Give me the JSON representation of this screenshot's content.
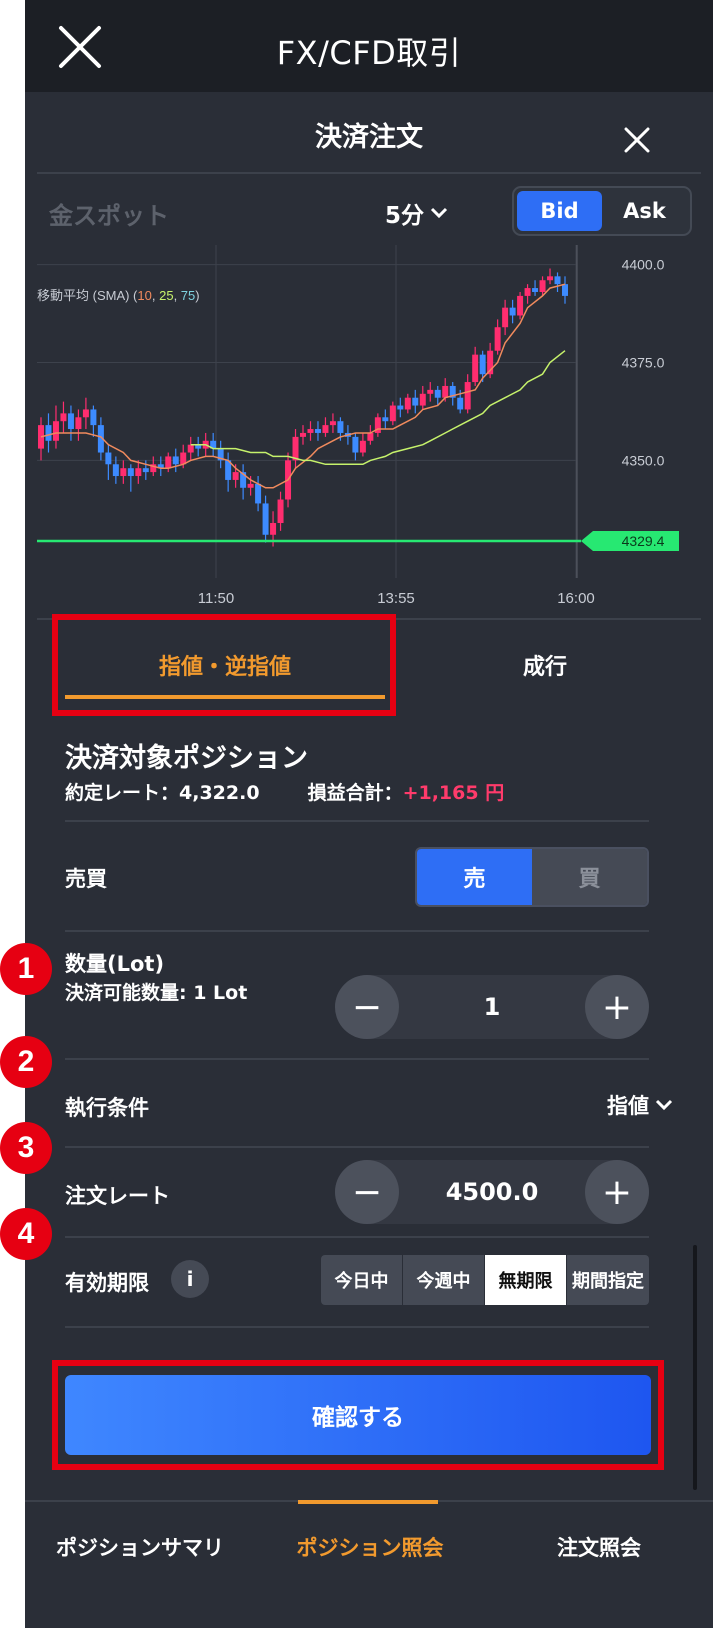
{
  "topbar": {
    "title": "FX/CFD取引",
    "close_icon": "close-icon"
  },
  "modal": {
    "title": "決済注文"
  },
  "chart_header": {
    "symbol": "金スポット",
    "interval": "5分",
    "bid": "Bid",
    "ask": "Ask",
    "selected": "Bid"
  },
  "chart_data": {
    "type": "candlestick",
    "indicator_label": "移動平均 (SMA) (",
    "sma_periods": [
      "10",
      "25",
      "75"
    ],
    "sma_colors": [
      "#f08a5d",
      "#c6f26b",
      "#7fd3e0"
    ],
    "y_ticks": [
      "4400.0",
      "4375.0",
      "4350.0"
    ],
    "y_tick_values": [
      4400,
      4375,
      4350
    ],
    "x_ticks": [
      "11:50",
      "13:55",
      "16:00"
    ],
    "ylim": [
      4322,
      4405
    ],
    "current_price_label": "4329.4",
    "current_price": 4329.4,
    "candles": [
      {
        "o": 4353,
        "c": 4359,
        "h": 4361,
        "l": 4350
      },
      {
        "o": 4359,
        "c": 4355,
        "h": 4362,
        "l": 4352
      },
      {
        "o": 4355,
        "c": 4360,
        "h": 4364,
        "l": 4353
      },
      {
        "o": 4360,
        "c": 4362,
        "h": 4365,
        "l": 4357
      },
      {
        "o": 4362,
        "c": 4358,
        "h": 4364,
        "l": 4355
      },
      {
        "o": 4358,
        "c": 4361,
        "h": 4363,
        "l": 4355
      },
      {
        "o": 4361,
        "c": 4363,
        "h": 4366,
        "l": 4358
      },
      {
        "o": 4363,
        "c": 4359,
        "h": 4364,
        "l": 4356
      },
      {
        "o": 4359,
        "c": 4352,
        "h": 4361,
        "l": 4350
      },
      {
        "o": 4352,
        "c": 4349,
        "h": 4354,
        "l": 4345
      },
      {
        "o": 4349,
        "c": 4346,
        "h": 4351,
        "l": 4344
      },
      {
        "o": 4346,
        "c": 4348,
        "h": 4350,
        "l": 4344
      },
      {
        "o": 4348,
        "c": 4346,
        "h": 4349,
        "l": 4342
      },
      {
        "o": 4346,
        "c": 4348,
        "h": 4350,
        "l": 4344
      },
      {
        "o": 4348,
        "c": 4347,
        "h": 4350,
        "l": 4345
      },
      {
        "o": 4347,
        "c": 4349,
        "h": 4351,
        "l": 4346
      },
      {
        "o": 4349,
        "c": 4348,
        "h": 4351,
        "l": 4346
      },
      {
        "o": 4348,
        "c": 4351,
        "h": 4352,
        "l": 4347
      },
      {
        "o": 4351,
        "c": 4349,
        "h": 4353,
        "l": 4347
      },
      {
        "o": 4349,
        "c": 4352,
        "h": 4354,
        "l": 4348
      },
      {
        "o": 4352,
        "c": 4354,
        "h": 4356,
        "l": 4350
      },
      {
        "o": 4354,
        "c": 4353,
        "h": 4356,
        "l": 4351
      },
      {
        "o": 4353,
        "c": 4355,
        "h": 4357,
        "l": 4351
      },
      {
        "o": 4355,
        "c": 4353,
        "h": 4357,
        "l": 4351
      },
      {
        "o": 4353,
        "c": 4350,
        "h": 4355,
        "l": 4348
      },
      {
        "o": 4350,
        "c": 4345,
        "h": 4352,
        "l": 4342
      },
      {
        "o": 4345,
        "c": 4347,
        "h": 4349,
        "l": 4343
      },
      {
        "o": 4347,
        "c": 4343,
        "h": 4349,
        "l": 4340
      },
      {
        "o": 4343,
        "c": 4344,
        "h": 4346,
        "l": 4341
      },
      {
        "o": 4344,
        "c": 4339,
        "h": 4346,
        "l": 4337
      },
      {
        "o": 4339,
        "c": 4331,
        "h": 4341,
        "l": 4329
      },
      {
        "o": 4331,
        "c": 4334,
        "h": 4337,
        "l": 4328
      },
      {
        "o": 4334,
        "c": 4340,
        "h": 4342,
        "l": 4332
      },
      {
        "o": 4340,
        "c": 4350,
        "h": 4352,
        "l": 4338
      },
      {
        "o": 4350,
        "c": 4356,
        "h": 4358,
        "l": 4348
      },
      {
        "o": 4356,
        "c": 4357,
        "h": 4359,
        "l": 4354
      },
      {
        "o": 4357,
        "c": 4358,
        "h": 4360,
        "l": 4355
      },
      {
        "o": 4358,
        "c": 4357,
        "h": 4360,
        "l": 4355
      },
      {
        "o": 4357,
        "c": 4359,
        "h": 4361,
        "l": 4356
      },
      {
        "o": 4359,
        "c": 4360,
        "h": 4362,
        "l": 4357
      },
      {
        "o": 4360,
        "c": 4357,
        "h": 4361,
        "l": 4355
      },
      {
        "o": 4357,
        "c": 4356,
        "h": 4359,
        "l": 4354
      },
      {
        "o": 4356,
        "c": 4352,
        "h": 4357,
        "l": 4350
      },
      {
        "o": 4352,
        "c": 4355,
        "h": 4357,
        "l": 4351
      },
      {
        "o": 4355,
        "c": 4357,
        "h": 4359,
        "l": 4354
      },
      {
        "o": 4357,
        "c": 4361,
        "h": 4362,
        "l": 4356
      },
      {
        "o": 4361,
        "c": 4360,
        "h": 4363,
        "l": 4358
      },
      {
        "o": 4360,
        "c": 4364,
        "h": 4365,
        "l": 4359
      },
      {
        "o": 4364,
        "c": 4363,
        "h": 4366,
        "l": 4361
      },
      {
        "o": 4363,
        "c": 4366,
        "h": 4367,
        "l": 4362
      },
      {
        "o": 4366,
        "c": 4364,
        "h": 4368,
        "l": 4362
      },
      {
        "o": 4364,
        "c": 4367,
        "h": 4369,
        "l": 4363
      },
      {
        "o": 4367,
        "c": 4368,
        "h": 4370,
        "l": 4365
      },
      {
        "o": 4368,
        "c": 4366,
        "h": 4369,
        "l": 4364
      },
      {
        "o": 4366,
        "c": 4369,
        "h": 4371,
        "l": 4365
      },
      {
        "o": 4369,
        "c": 4366,
        "h": 4370,
        "l": 4364
      },
      {
        "o": 4366,
        "c": 4363,
        "h": 4368,
        "l": 4362
      },
      {
        "o": 4363,
        "c": 4370,
        "h": 4372,
        "l": 4362
      },
      {
        "o": 4370,
        "c": 4377,
        "h": 4379,
        "l": 4369
      },
      {
        "o": 4377,
        "c": 4372,
        "h": 4378,
        "l": 4370
      },
      {
        "o": 4372,
        "c": 4378,
        "h": 4380,
        "l": 4371
      },
      {
        "o": 4378,
        "c": 4384,
        "h": 4386,
        "l": 4377
      },
      {
        "o": 4384,
        "c": 4389,
        "h": 4391,
        "l": 4382
      },
      {
        "o": 4389,
        "c": 4387,
        "h": 4391,
        "l": 4385
      },
      {
        "o": 4387,
        "c": 4392,
        "h": 4393,
        "l": 4386
      },
      {
        "o": 4392,
        "c": 4394,
        "h": 4395,
        "l": 4390
      },
      {
        "o": 4394,
        "c": 4393,
        "h": 4396,
        "l": 4392
      },
      {
        "o": 4393,
        "c": 4396,
        "h": 4397,
        "l": 4392
      },
      {
        "o": 4396,
        "c": 4397,
        "h": 4399,
        "l": 4395
      },
      {
        "o": 4397,
        "c": 4395,
        "h": 4398,
        "l": 4393
      },
      {
        "o": 4395,
        "c": 4392,
        "h": 4397,
        "l": 4390
      }
    ],
    "sma10": [
      4356,
      4357,
      4357,
      4357,
      4357,
      4356,
      4354,
      4352,
      4350,
      4349,
      4348,
      4348,
      4349,
      4350,
      4351,
      4351,
      4350,
      4348,
      4345,
      4343,
      4343,
      4345,
      4348,
      4351,
      4353,
      4355,
      4356,
      4357,
      4357,
      4358,
      4358,
      4359,
      4361,
      4363,
      4364,
      4366,
      4367,
      4368,
      4371,
      4375,
      4380,
      4385,
      4389,
      4392,
      4394,
      4395
    ],
    "sma25": [
      4354,
      4354,
      4353,
      4353,
      4353,
      4352,
      4352,
      4351,
      4351,
      4350,
      4350,
      4349,
      4349,
      4349,
      4349,
      4350,
      4351,
      4352,
      4353,
      4354,
      4355,
      4357,
      4358,
      4360,
      4362,
      4364,
      4366,
      4368,
      4370,
      4372,
      4375,
      4378
    ],
    "sma75": []
  },
  "order_tabs": {
    "limit": "指値・逆指値",
    "market": "成行"
  },
  "position": {
    "title": "決済対象ポジション",
    "rate_label": "約定レート：",
    "rate_value": "4,322.0",
    "pl_label": "損益合計：",
    "pl_value": "+1,165 円"
  },
  "buysell": {
    "label": "売買",
    "sell": "売",
    "buy": "買"
  },
  "quantity": {
    "label": "数量(Lot)",
    "sub": "決済可能数量: 1 Lot",
    "value": "1",
    "minus": "−",
    "plus": "+"
  },
  "condition": {
    "label": "執行条件",
    "value": "指値"
  },
  "rate": {
    "label": "注文レート",
    "value": "4500.0",
    "minus": "−",
    "plus": "+"
  },
  "expiry": {
    "label": "有効期限",
    "info": "i",
    "options": [
      "今日中",
      "今週中",
      "無期限",
      "期間指定"
    ],
    "selected": "無期限"
  },
  "confirm": {
    "label": "確認する"
  },
  "bottom_nav": [
    "ポジションサマリ",
    "ポジション照会",
    "注文照会"
  ],
  "markers": [
    "1",
    "2",
    "3",
    "4"
  ],
  "colors": {
    "accent": "#f29a2e",
    "up": "#ff2d6f",
    "down": "#3d8bff",
    "blue": "#2e6ef5",
    "highlight": "#e60012",
    "price_line": "#27e872"
  }
}
